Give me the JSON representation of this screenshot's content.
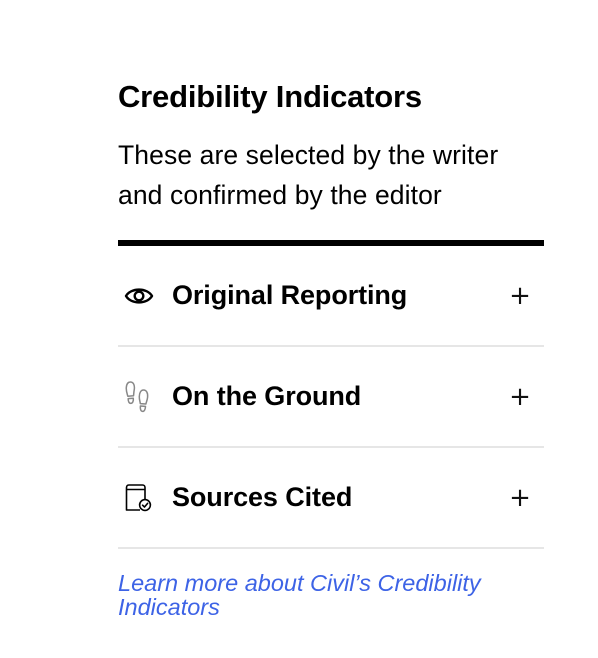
{
  "panel": {
    "title": "Credibility Indicators",
    "subtitle": "These are selected by the writer and confirmed by the editor"
  },
  "indicators": [
    {
      "icon": "eye-icon",
      "label": "Original Reporting",
      "toggle": "+"
    },
    {
      "icon": "footprints-icon",
      "label": "On the Ground",
      "toggle": "+"
    },
    {
      "icon": "document-check-icon",
      "label": "Sources Cited",
      "toggle": "+"
    }
  ],
  "learn_more": {
    "text": "Learn more about Civil’s Credibility Indicators"
  },
  "colors": {
    "text": "#000000",
    "link": "#3d63e6",
    "divider": "#e6e6e6",
    "icon_muted": "#888888"
  }
}
